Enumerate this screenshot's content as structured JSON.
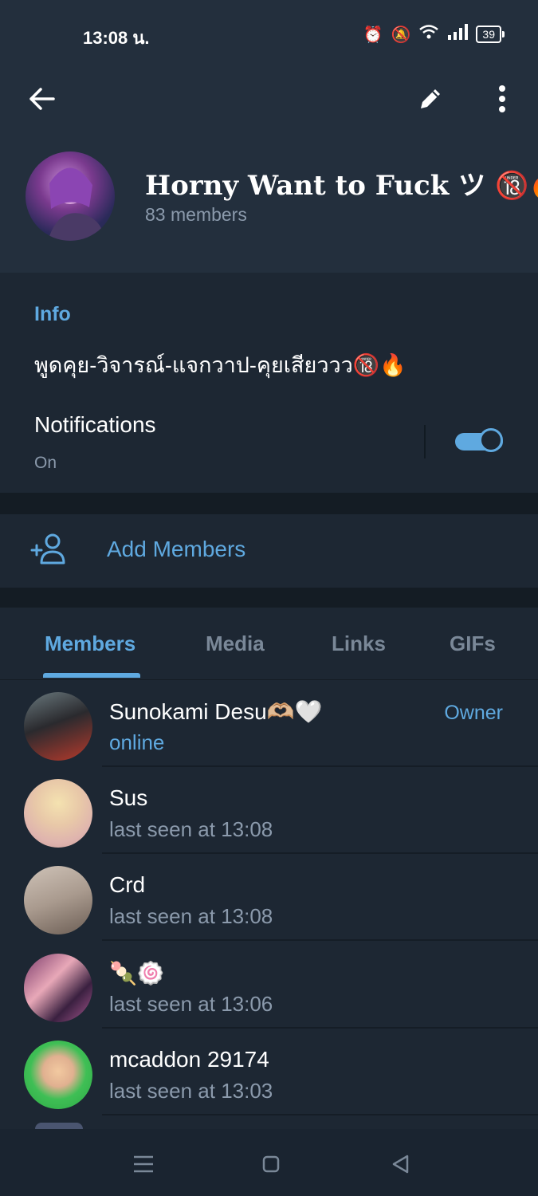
{
  "status_bar": {
    "time": "13:08 น.",
    "battery": "39"
  },
  "group": {
    "title": "Horny Want to Fuck ツ 🔞🔥",
    "member_count": "83 members"
  },
  "info": {
    "heading": "Info",
    "description": "พูดคุย-วิจารณ์-แจกวาป-คุยเสียววว🔞🔥",
    "notifications_label": "Notifications",
    "notifications_status": "On",
    "notifications_enabled": true
  },
  "add_members": {
    "label": "Add Members"
  },
  "tabs": [
    {
      "label": "Members",
      "active": true
    },
    {
      "label": "Media",
      "active": false
    },
    {
      "label": "Links",
      "active": false
    },
    {
      "label": "GIFs",
      "active": false
    }
  ],
  "members": [
    {
      "name": "Sunokami Desu🫶🏼🤍",
      "status": "online",
      "role": "Owner"
    },
    {
      "name": "Sus",
      "status": "last seen at 13:08",
      "role": ""
    },
    {
      "name": "Crd",
      "status": "last seen at 13:08",
      "role": ""
    },
    {
      "name": "🍡🍥",
      "status": "last seen at 13:06",
      "role": ""
    },
    {
      "name": "mcaddon 29174",
      "status": "last seen at 13:03",
      "role": ""
    }
  ],
  "colors": {
    "accent": "#5fa9e0",
    "background": "#1d2733",
    "header": "#232f3d",
    "muted": "#8b9aac"
  }
}
